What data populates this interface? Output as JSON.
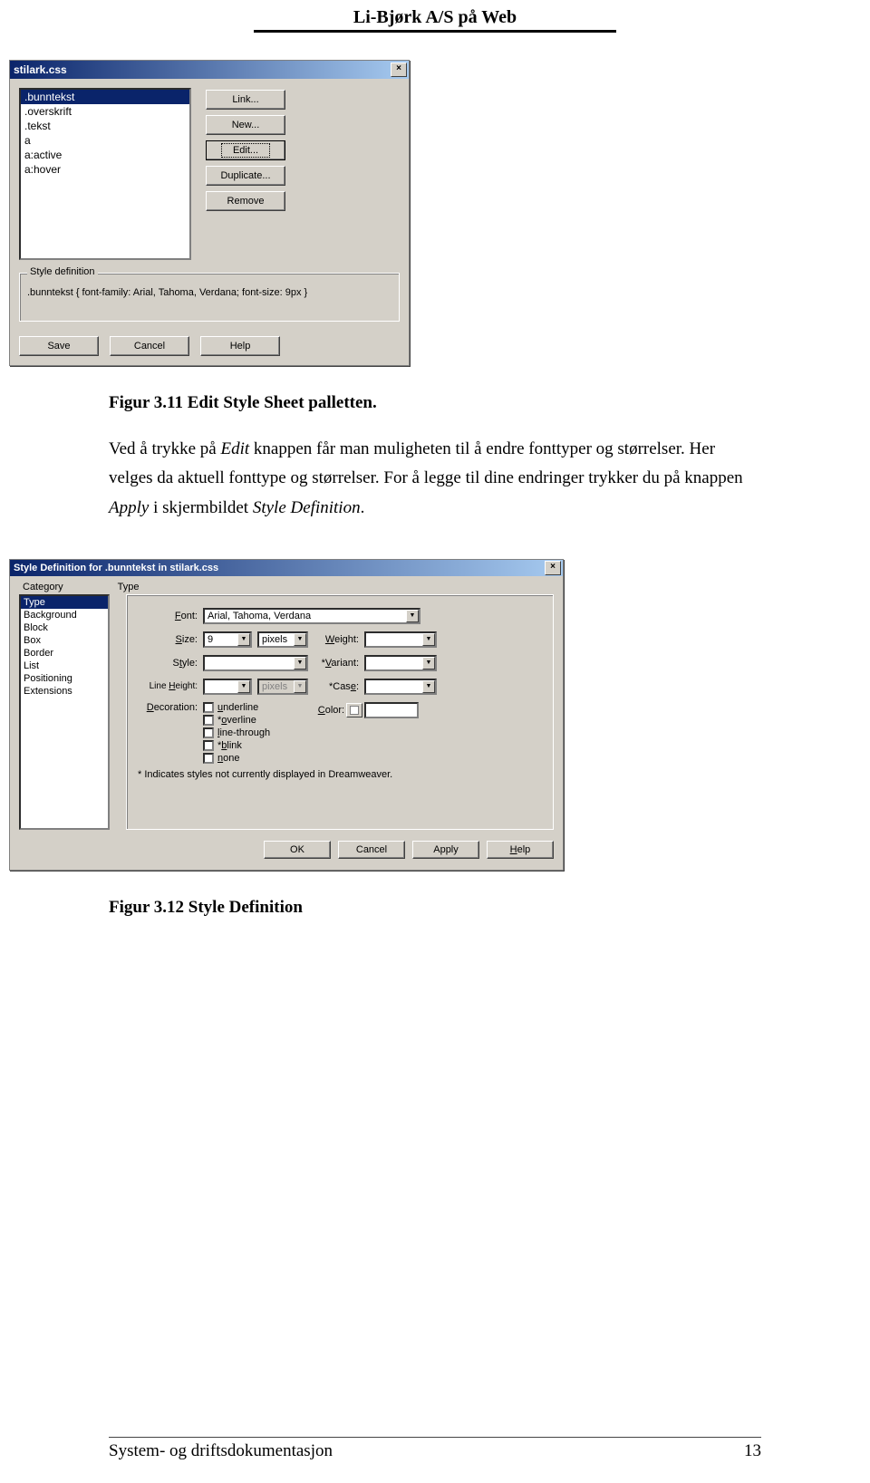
{
  "header": {
    "title": "Li-Bjørk A/S på Web"
  },
  "dialog1": {
    "title": "stilark.css",
    "close": "×",
    "list": [
      ".bunntekst",
      ".overskrift",
      ".tekst",
      "a",
      "a:active",
      "a:hover"
    ],
    "selected_index": 0,
    "buttons": {
      "link": "Link...",
      "new": "New...",
      "edit": "Edit...",
      "duplicate": "Duplicate...",
      "remove": "Remove"
    },
    "fieldset_legend": "Style definition",
    "style_def": ".bunntekst { font-family: Arial, Tahoma, Verdana; font-size: 9px }",
    "bottom": {
      "save": "Save",
      "cancel": "Cancel",
      "help": "Help"
    }
  },
  "caption1": "Figur 3.11 Edit Style Sheet palletten.",
  "para1": {
    "t1": "Ved å trykke på ",
    "edit": "Edit",
    "t2": " knappen får man muligheten til å endre fonttyper og størrelser. Her velges da aktuell fonttype og størrelser. For å legge til dine endringer trykker du på knappen ",
    "apply": "Apply",
    "t3": "  i skjermbildet ",
    "styledef": "Style Definition",
    "t4": "."
  },
  "dialog2": {
    "title": "Style Definition for .bunntekst in stilark.css",
    "close": "×",
    "headers": {
      "category": "Category",
      "type": "Type"
    },
    "categories": [
      "Type",
      "Background",
      "Block",
      "Box",
      "Border",
      "List",
      "Positioning",
      "Extensions"
    ],
    "selected_cat_index": 0,
    "labels": {
      "font": "Font:",
      "size": "Size:",
      "weight": "Weight:",
      "style": "Style:",
      "variant": "*Variant:",
      "lineheight": "Line Height:",
      "case": "*Case:",
      "decoration": "Decoration:",
      "color": "Color:"
    },
    "values": {
      "font": "Arial, Tahoma, Verdana",
      "size": "9",
      "size_unit": "pixels",
      "lh_unit": "pixels"
    },
    "decorations": {
      "underline": "underline",
      "overline": "*overline",
      "linethrough": "line-through",
      "blink": "*blink",
      "none": "none"
    },
    "starnote": "* Indicates styles not currently displayed in Dreamweaver.",
    "bottom": {
      "ok": "OK",
      "cancel": "Cancel",
      "apply": "Apply",
      "help": "Help"
    }
  },
  "caption2": "Figur 3.12 Style Definition",
  "footer": {
    "text": "System- og driftsdokumentasjon",
    "page": "13"
  }
}
